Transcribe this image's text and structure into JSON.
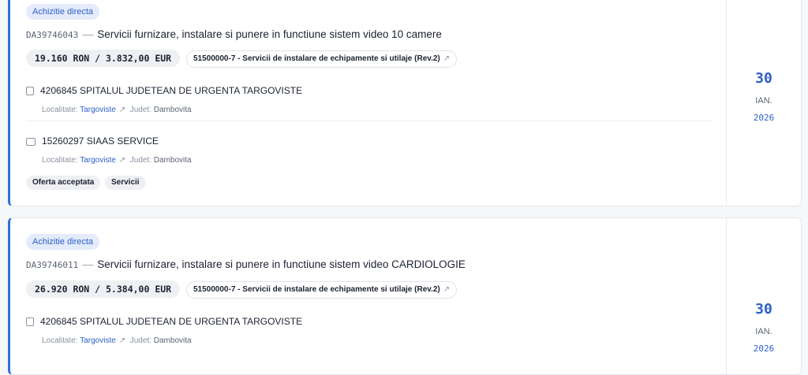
{
  "cards": [
    {
      "type_badge": "Achizitie directa",
      "doc_id": "DA39746043",
      "separator": "—",
      "title": "Servicii furnizare, instalare si punere in functiune sistem video 10 camere",
      "amount": "19.160 RON / 3.832,00 EUR",
      "cpv": "51500000-7 - Servicii de instalare de echipamente si utilaje (Rev.2)",
      "authority": {
        "name": "4206845 SPITALUL JUDETEAN DE URGENTA TARGOVISTE",
        "localitate_label": "Localitate:",
        "localitate": "Targoviste",
        "judet_label": "Judet:",
        "judet": "Dambovita"
      },
      "supplier": {
        "name": "15260297 SIAAS SERVICE",
        "localitate_label": "Localitate:",
        "localitate": "Targoviste",
        "judet_label": "Judet:",
        "judet": "Dambovita"
      },
      "tags": [
        "Oferta acceptata",
        "Servicii"
      ],
      "date": {
        "day": "30",
        "month": "IAN.",
        "year": "2026"
      }
    },
    {
      "type_badge": "Achizitie directa",
      "doc_id": "DA39746011",
      "separator": "—",
      "title": "Servicii furnizare, instalare si punere in functiune sistem video CARDIOLOGIE",
      "amount": "26.920 RON / 5.384,00 EUR",
      "cpv": "51500000-7 - Servicii de instalare de echipamente si utilaje (Rev.2)",
      "authority": {
        "name": "4206845 SPITALUL JUDETEAN DE URGENTA TARGOVISTE",
        "localitate_label": "Localitate:",
        "localitate": "Targoviste",
        "judet_label": "Judet:",
        "judet": "Dambovita"
      },
      "date": {
        "day": "30",
        "month": "IAN.",
        "year": "2026"
      }
    }
  ],
  "icons": {
    "external_link": "external-link-icon",
    "authority": "building-icon",
    "supplier": "briefcase-icon"
  },
  "colors": {
    "accent": "#2f6fe0",
    "badge_bg": "#e4ebfb"
  }
}
